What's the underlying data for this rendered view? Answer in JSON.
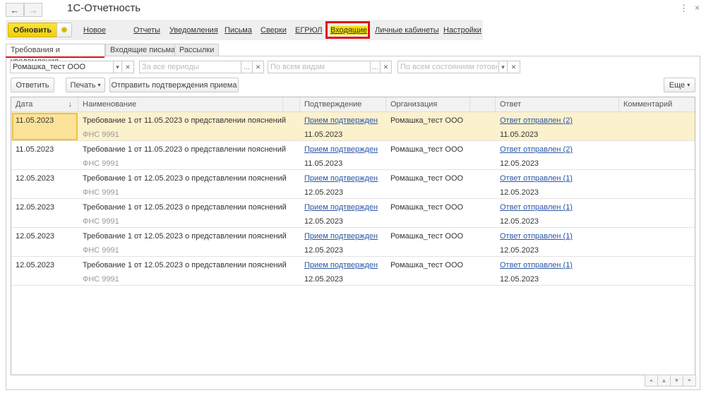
{
  "window": {
    "title": "1С-Отчетность",
    "back_icon": "←",
    "forward_icon": "→",
    "more_icon": "⋮",
    "close_icon": "×"
  },
  "toolbar": {
    "refresh": "Обновить",
    "links": [
      "Новое",
      "Отчеты",
      "Уведомления",
      "Письма",
      "Сверки",
      "ЕГРЮЛ",
      "Входящие",
      "Личные кабинеты",
      "Настройки"
    ],
    "active": "Входящие"
  },
  "tabs": [
    "Требования и уведомления",
    "Входящие письма",
    "Рассылки"
  ],
  "filters": {
    "organization": "Ромашка_тест ООО",
    "period_placeholder": "За все периоды",
    "kind_placeholder": "По всем видам",
    "state_placeholder": "По всем состояниям готовн..."
  },
  "actions": {
    "reply": "Ответить",
    "print": "Печать",
    "send_confirm": "Отправить подтверждения приема",
    "more": "Еще"
  },
  "table": {
    "columns": [
      "Дата",
      "Наименование",
      "Подтверждение",
      "Организация",
      "Ответ",
      "Комментарий"
    ],
    "sort_icon": "↓",
    "rows": [
      {
        "date": "11.05.2023",
        "name": "Требование 1 от 11.05.2023 о представлении пояснений",
        "sender": "ФНС 9991",
        "confirm": "Прием подтвержден",
        "confirm_date": "11.05.2023",
        "org": "Ромашка_тест ООО",
        "answer": "Ответ отправлен (2)",
        "answer_date": "11.05.2023",
        "comment": ""
      },
      {
        "date": "11.05.2023",
        "name": "Требование 1 от 11.05.2023 о представлении пояснений",
        "sender": "ФНС 9991",
        "confirm": "Прием подтвержден",
        "confirm_date": "11.05.2023",
        "org": "Ромашка_тест ООО",
        "answer": "Ответ отправлен (2)",
        "answer_date": "12.05.2023",
        "comment": ""
      },
      {
        "date": "12.05.2023",
        "name": "Требование 1 от 12.05.2023 о представлении пояснений",
        "sender": "ФНС 9991",
        "confirm": "Прием подтвержден",
        "confirm_date": "12.05.2023",
        "org": "Ромашка_тест ООО",
        "answer": "Ответ отправлен (1)",
        "answer_date": "12.05.2023",
        "comment": ""
      },
      {
        "date": "12.05.2023",
        "name": "Требование 1 от 12.05.2023 о представлении пояснений",
        "sender": "ФНС 9991",
        "confirm": "Прием подтвержден",
        "confirm_date": "12.05.2023",
        "org": "Ромашка_тест ООО",
        "answer": "Ответ отправлен (1)",
        "answer_date": "12.05.2023",
        "comment": ""
      },
      {
        "date": "12.05.2023",
        "name": "Требование 1 от 12.05.2023 о представлении пояснений",
        "sender": "ФНС 9991",
        "confirm": "Прием подтвержден",
        "confirm_date": "12.05.2023",
        "org": "Ромашка_тест ООО",
        "answer": "Ответ отправлен (1)",
        "answer_date": "12.05.2023",
        "comment": ""
      },
      {
        "date": "12.05.2023",
        "name": "Требование 1 от 12.05.2023 о представлении пояснений",
        "sender": "ФНС 9991",
        "confirm": "Прием подтвержден",
        "confirm_date": "12.05.2023",
        "org": "Ромашка_тест ООО",
        "answer": "Ответ отправлен (1)",
        "answer_date": "12.05.2023",
        "comment": ""
      }
    ]
  },
  "colors": {
    "accent_yellow": "#f5d800",
    "highlight": "#e0101a",
    "selected_row": "#fbf1cc",
    "link": "#2b56a5"
  }
}
